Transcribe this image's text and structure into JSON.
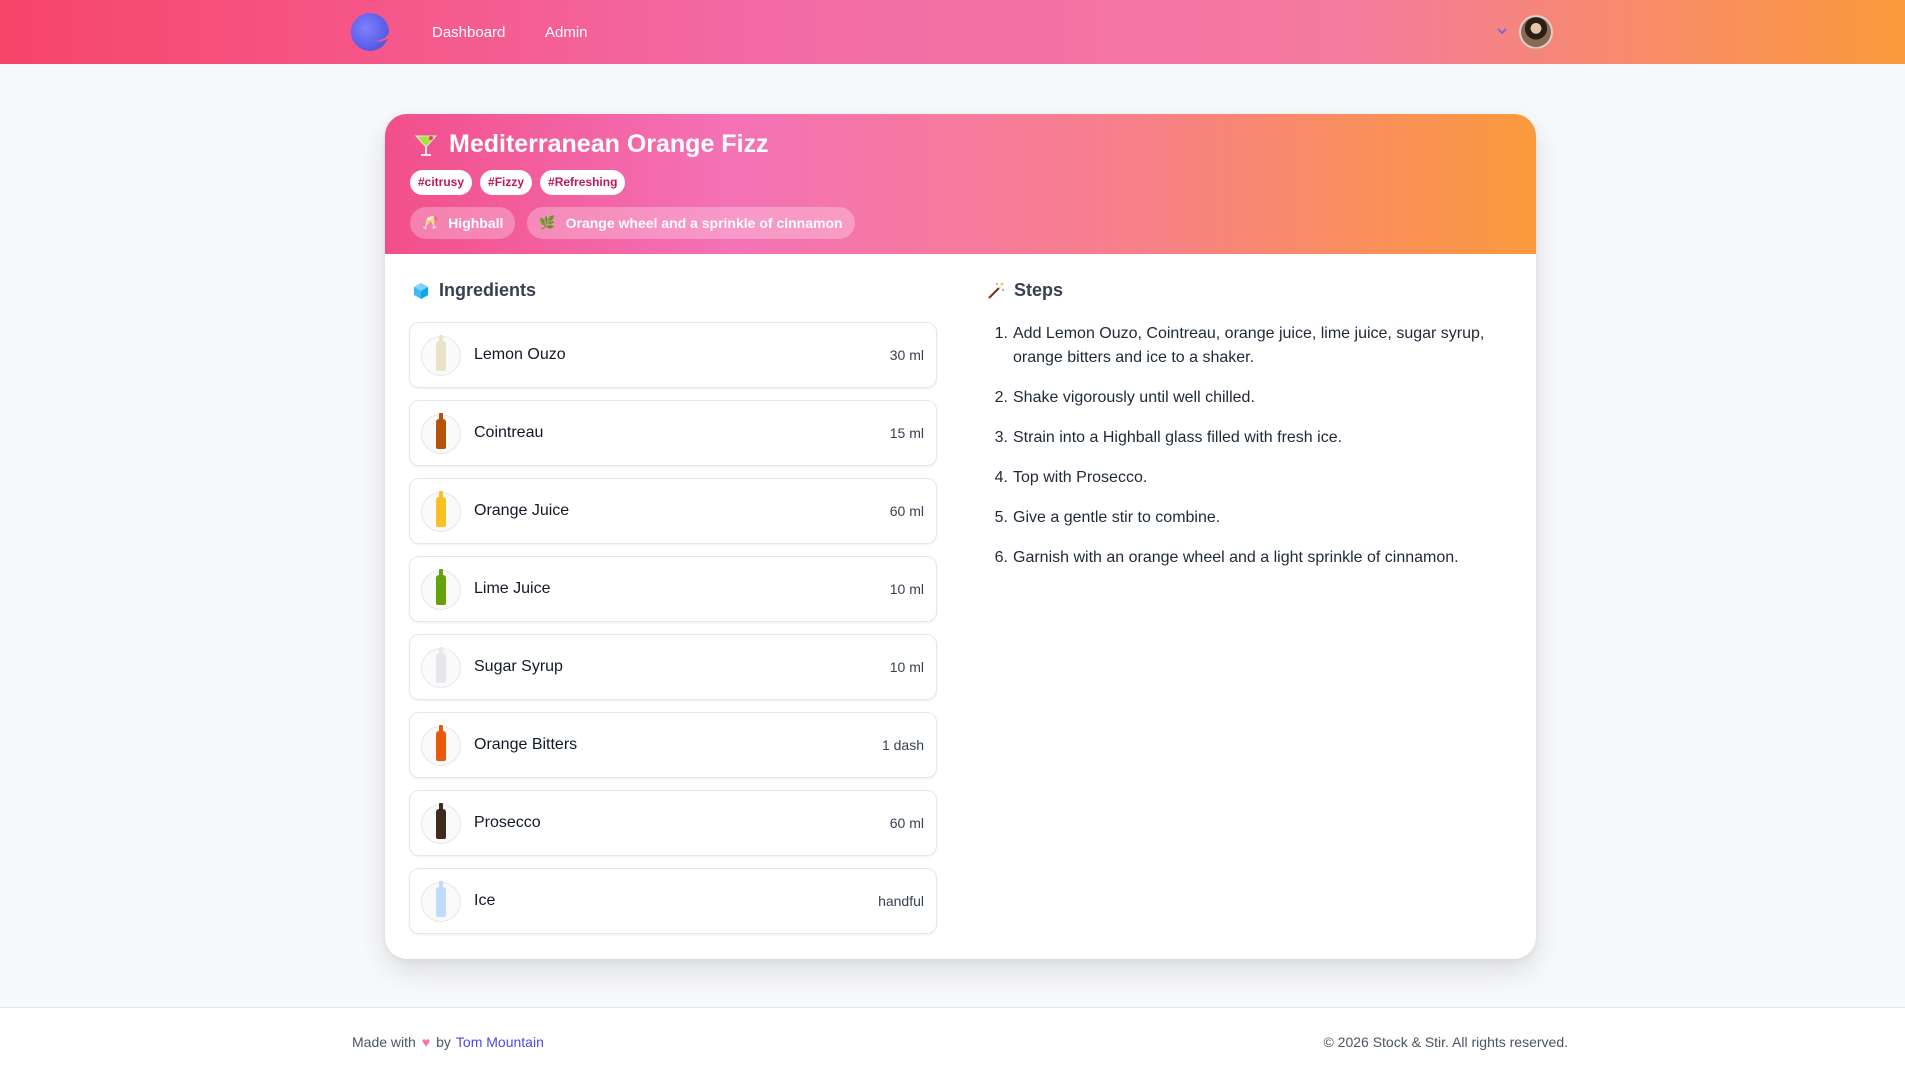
{
  "nav": {
    "links": [
      "Dashboard",
      "Admin"
    ]
  },
  "recipe": {
    "title": "Mediterranean Orange Fizz",
    "tags": [
      "#citrusy",
      "#Fizzy",
      "#Refreshing"
    ],
    "glass": "Highball",
    "garnish": "Orange wheel and a sprinkle of cinnamon"
  },
  "ingredients": {
    "heading": "Ingredients",
    "items": [
      {
        "name": "Lemon Ouzo",
        "qty": "30 ml",
        "color": "#e9e3c8"
      },
      {
        "name": "Cointreau",
        "qty": "15 ml",
        "color": "#b45309"
      },
      {
        "name": "Orange Juice",
        "qty": "60 ml",
        "color": "#fbbf24"
      },
      {
        "name": "Lime Juice",
        "qty": "10 ml",
        "color": "#65a30d"
      },
      {
        "name": "Sugar Syrup",
        "qty": "10 ml",
        "color": "#e5e7eb"
      },
      {
        "name": "Orange Bitters",
        "qty": "1 dash",
        "color": "#ea580c"
      },
      {
        "name": "Prosecco",
        "qty": "60 ml",
        "color": "#3f2a1d"
      },
      {
        "name": "Ice",
        "qty": "handful",
        "color": "#bfdbfe"
      }
    ]
  },
  "steps": {
    "heading": "Steps",
    "items": [
      "Add Lemon Ouzo, Cointreau, orange juice, lime juice, sugar syrup, orange bitters and ice to a shaker.",
      "Shake vigorously until well chilled.",
      "Strain into a Highball glass filled with fresh ice.",
      "Top with Prosecco.",
      "Give a gentle stir to combine.",
      "Garnish with an orange wheel and a light sprinkle of cinnamon."
    ]
  },
  "footer": {
    "made_with": "Made with",
    "by": "by",
    "author": "Tom Mountain",
    "copyright": "© 2026 Stock & Stir. All rights reserved."
  }
}
